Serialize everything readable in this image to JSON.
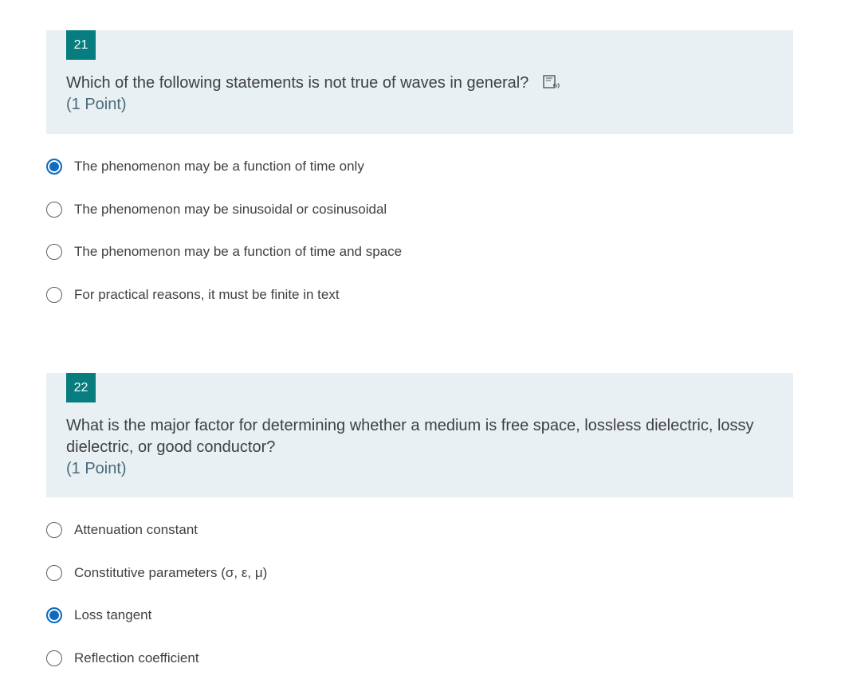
{
  "questions": [
    {
      "number": "21",
      "text": "Which of the following statements is not true of waves in general?",
      "points": "(1 Point)",
      "options": [
        {
          "label": "The phenomenon may be a function of time only",
          "selected": true
        },
        {
          "label": "The phenomenon may be sinusoidal or cosinusoidal",
          "selected": false
        },
        {
          "label": "The phenomenon may be a function of time and space",
          "selected": false
        },
        {
          "label": "For practical reasons, it must be finite in text",
          "selected": false
        }
      ]
    },
    {
      "number": "22",
      "text": "What is the major factor for determining whether a medium is free space, lossless dielectric, lossy dielectric, or good conductor?",
      "points": "(1 Point)",
      "options": [
        {
          "label": "Attenuation constant",
          "selected": false
        },
        {
          "label": "Constitutive parameters (σ, ε, μ)",
          "selected": false
        },
        {
          "label": "Loss tangent",
          "selected": true
        },
        {
          "label": "Reflection coefficient",
          "selected": false
        }
      ]
    }
  ],
  "icons": {
    "immersive_reader": "immersive-reader-icon"
  },
  "colors": {
    "accent": "#0f6cbd",
    "number_badge": "#077d7f",
    "header_bg": "#e8f0f3"
  }
}
